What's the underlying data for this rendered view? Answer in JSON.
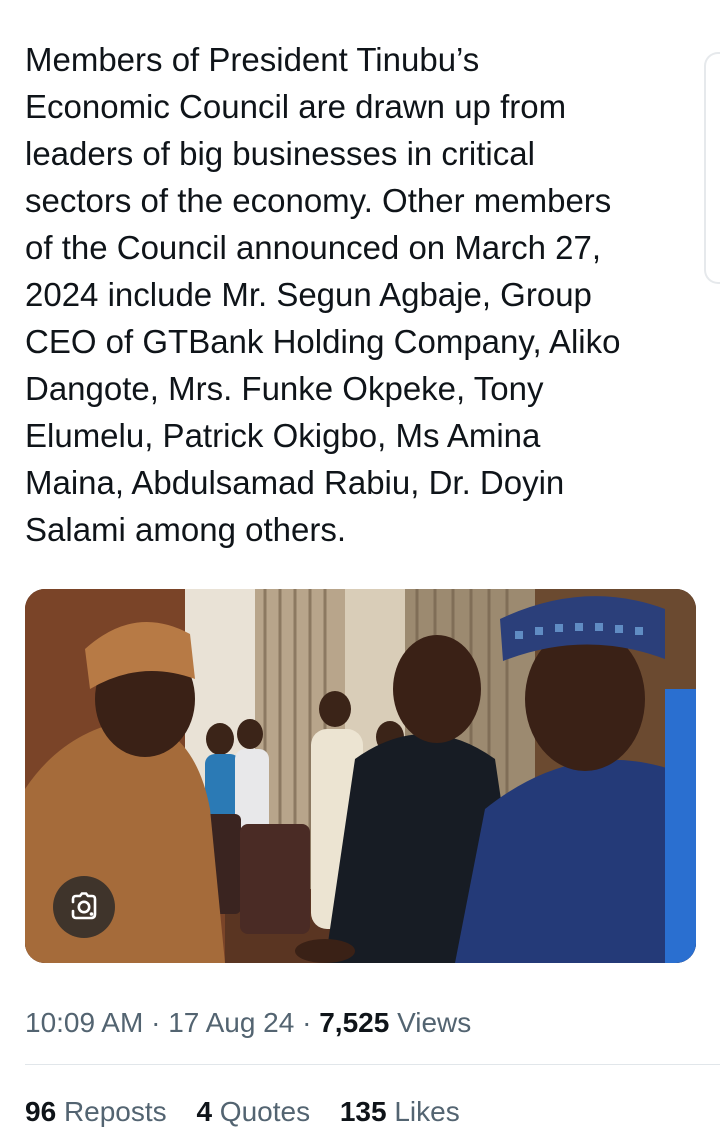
{
  "tweet": {
    "text": "Members of President Tinubu’s\nEconomic Council are drawn up from\nleaders of big businesses in critical\nsectors of the economy. Other members\nof the Council announced on March 27,\n2024 include Mr. Segun Agbaje, Group\nCEO of GTBank Holding Company, Aliko\nDangote, Mrs. Funke Okpeke, Tony\nElumelu, Patrick Okigbo, Ms Amina\nMaina, Abdulsamad Rabiu, Dr. Doyin\nSalami among others."
  },
  "media": {
    "lens_icon": "google-lens-icon"
  },
  "meta": {
    "time": "10:09 AM",
    "separator": " · ",
    "date": "17 Aug 24",
    "views_count": "7,525",
    "views_label": "Views"
  },
  "stats": {
    "reposts_count": "96",
    "reposts_label": "Reposts",
    "quotes_count": "4",
    "quotes_label": "Quotes",
    "likes_count": "135",
    "likes_label": "Likes"
  }
}
